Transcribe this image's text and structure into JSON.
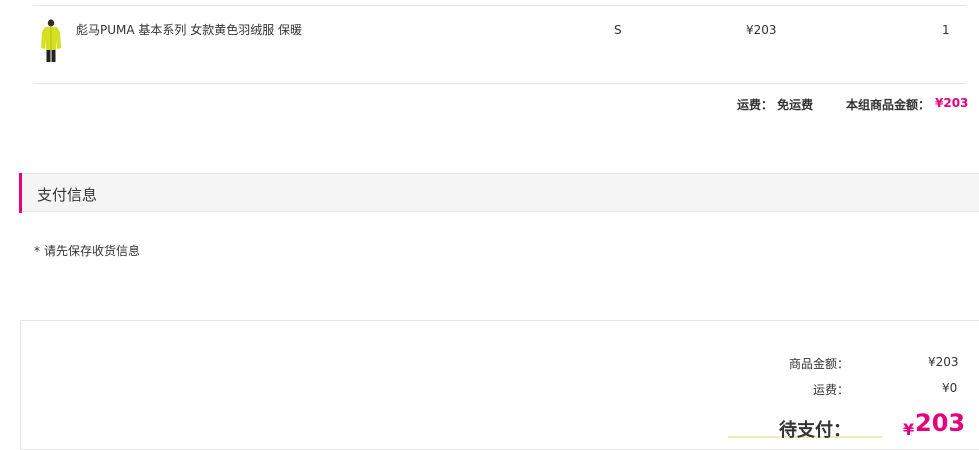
{
  "product": {
    "name": "彪马PUMA 基本系列 女款黄色羽绒服 保暖",
    "size": "S",
    "price": "¥203",
    "qty": "1",
    "image_icon": "yellow-down-jacket-thumbnail"
  },
  "group_summary": {
    "shipping_text": "运费： 免运费",
    "amount_label": "本组商品金额：",
    "amount_value": "¥203"
  },
  "payment_section": {
    "title": "支付信息",
    "notice_star": "*",
    "notice": "请先保存收货信息"
  },
  "order_summary": {
    "goods_label": "商品金额：",
    "goods_value": "¥203",
    "shipping_label": "运费：",
    "shipping_value": "¥0",
    "due_label": "待支付：",
    "due_currency": "¥",
    "due_amount": "203"
  },
  "colors": {
    "accent": "#e4007f",
    "border": "#e6e6e6",
    "section_bg": "#f5f5f5"
  }
}
